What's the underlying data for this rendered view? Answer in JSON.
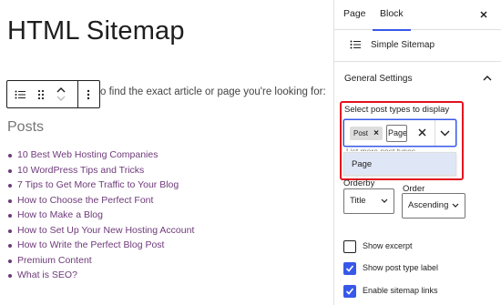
{
  "editor": {
    "title": "HTML Sitemap",
    "intro_text": "o find the exact article or page you're looking for:",
    "posts_heading": "Posts",
    "posts": [
      "10 Best Web Hosting Companies",
      "10 WordPress Tips and Tricks",
      "7 Tips to Get More Traffic to Your Blog",
      "How to Choose the Perfect Font",
      "How to Make a Blog",
      "How to Set Up Your New Hosting Account",
      "How to Write the Perfect Blog Post",
      "Premium Content",
      "What is SEO?"
    ],
    "link_color": "#6e3a7a"
  },
  "sidebar": {
    "tabs": {
      "page": "Page",
      "block": "Block",
      "active": "Block"
    },
    "block_card": {
      "name": "Simple Sitemap"
    },
    "panel": {
      "title": "General Settings",
      "expanded": true
    },
    "post_types": {
      "label": "Select post types to display",
      "selected_token": "Post",
      "input_value": "Page",
      "help_text": "List more post types",
      "suggestion": "Page"
    },
    "orderby": {
      "label": "Orderby",
      "value": "Title"
    },
    "order": {
      "label": "Order",
      "value": "Ascending"
    },
    "checkboxes": [
      {
        "label": "Show excerpt",
        "checked": false
      },
      {
        "label": "Show post type label",
        "checked": true
      },
      {
        "label": "Enable sitemap links",
        "checked": true
      }
    ]
  },
  "colors": {
    "accent": "#3858e9",
    "highlight": "#e3101e"
  }
}
